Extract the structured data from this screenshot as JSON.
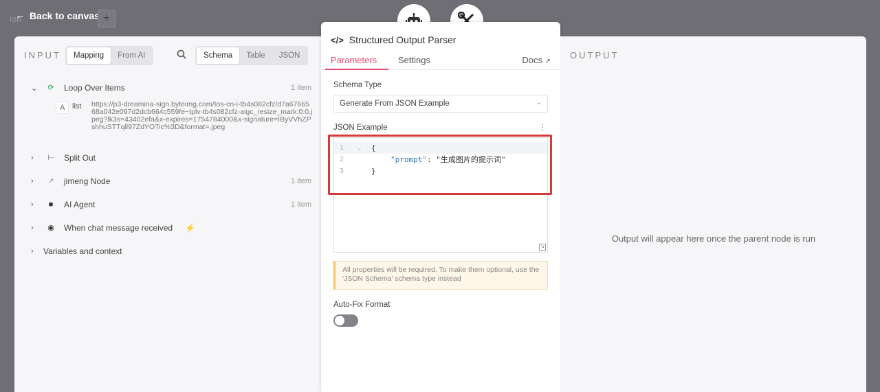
{
  "topbar": {
    "back_label": "Back to canvas",
    "ghost_text": "ion",
    "add_label": "+"
  },
  "input": {
    "title": "INPUT",
    "mode_tabs": [
      "Mapping",
      "From AI"
    ],
    "view_tabs": [
      "Schema",
      "Table",
      "JSON"
    ],
    "tree": {
      "loop": {
        "label": "Loop Over Items",
        "count": "1 item"
      },
      "list_type": "A",
      "list_key": "list",
      "list_value": "https://p3-dreamina-sign.byteimg.com/tos-cn-i-tb4s082cfz/d7a6766568a042e097d2dcb664c559fe~tplv-tb4s082cfz-aigc_resize_mark:0:0.jpeg?lk3s=43402efa&x-expires=1754784000&x-signature=IByVVhZPshhuSTTqll97ZdYOTic%3D&format=.jpeg",
      "split": {
        "label": "Split Out"
      },
      "jimeng": {
        "label": "jimeng Node",
        "count": "1 item"
      },
      "agent": {
        "label": "AI Agent",
        "count": "1 item"
      },
      "chat": {
        "label": "When chat message received"
      },
      "vars": {
        "label": "Variables and context"
      }
    }
  },
  "node": {
    "title": "Structured Output Parser",
    "tab_parameters": "Parameters",
    "tab_settings": "Settings",
    "docs": "Docs",
    "schema_type_label": "Schema Type",
    "schema_type_value": "Generate From JSON Example",
    "json_example_label": "JSON Example",
    "code": {
      "line1_no": "1",
      "line1": "{",
      "line2_no": "2",
      "line2_key": "\"prompt\"",
      "line2_sep": ": ",
      "line2_val": "\"生成图片的提示词\"",
      "line3_no": "3",
      "line3": "}"
    },
    "notice": "All properties will be required. To make them optional, use the 'JSON Schema' schema type instead",
    "autofix_label": "Auto-Fix Format",
    "autofix_on": false
  },
  "output": {
    "title": "OUTPUT",
    "empty_text": "Output will appear here once the parent node is run"
  },
  "colors": {
    "accent": "#ea4b71",
    "highlight": "#d33a3a",
    "loop_icon": "#23a55a",
    "trigger_icon": "#ef6a4c"
  }
}
